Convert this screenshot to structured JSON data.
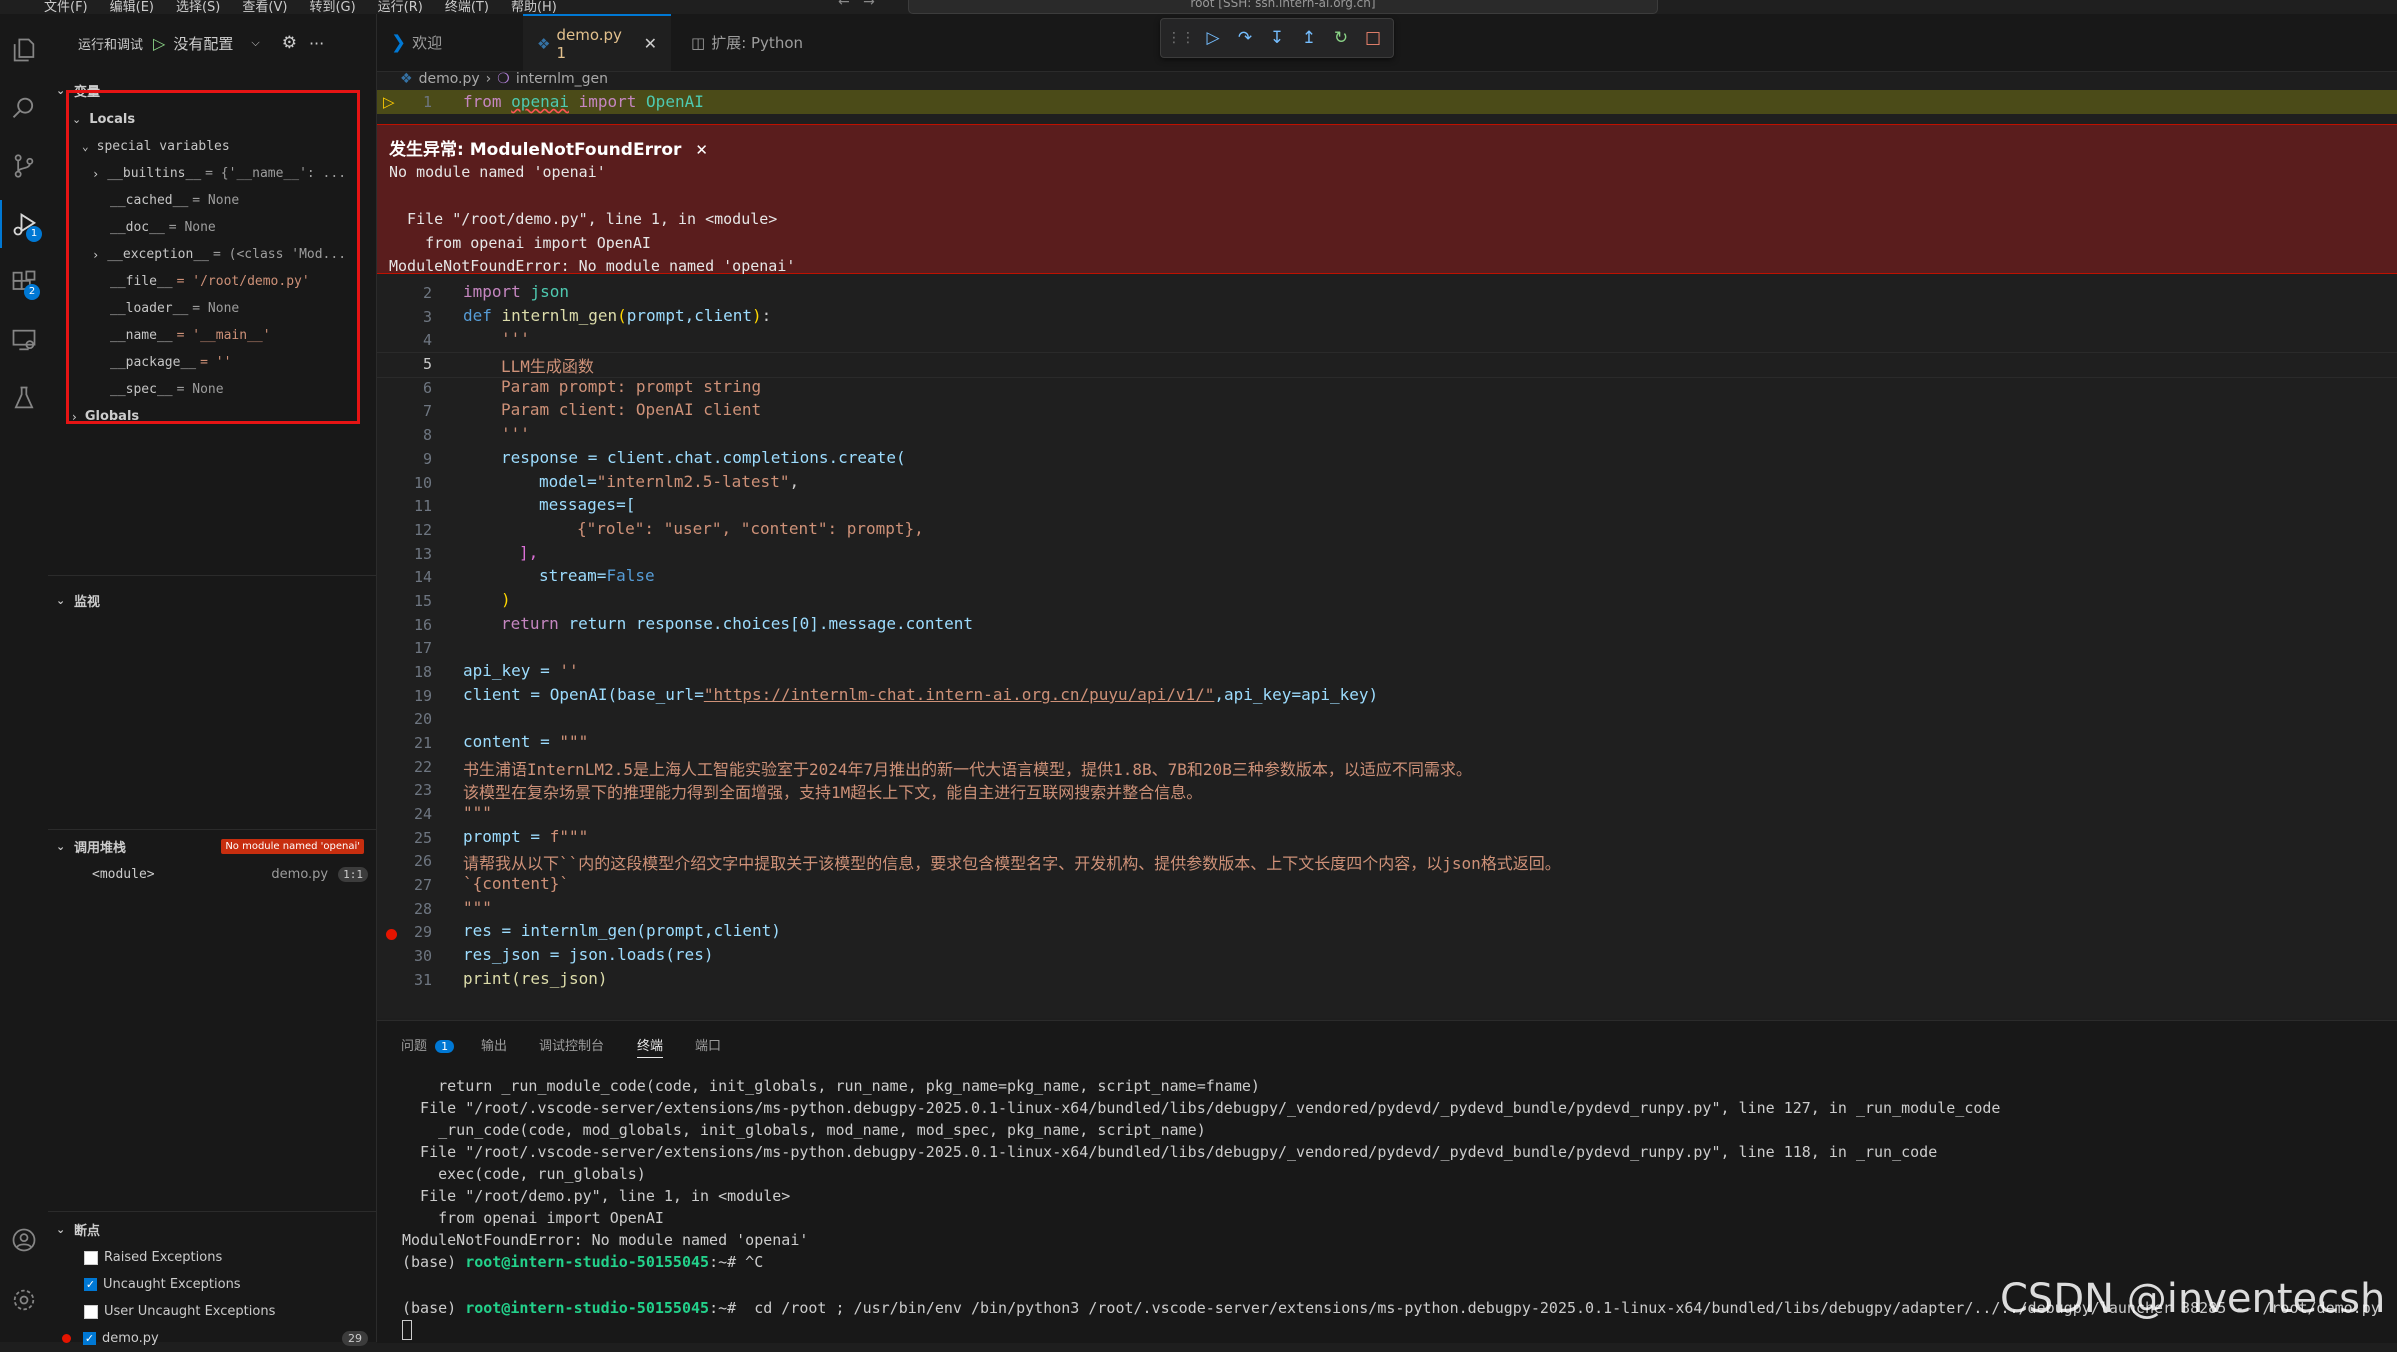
{
  "menu": [
    "文件(F)",
    "编辑(E)",
    "选择(S)",
    "查看(V)",
    "转到(G)",
    "运行(R)",
    "终端(T)",
    "帮助(H)"
  ],
  "command_center": "root [SSH: ssh.intern-ai.org.cn]",
  "activity_badges": {
    "debug": "1",
    "extensions": "2"
  },
  "sidebar": {
    "title": "运行和调试",
    "config": "没有配置",
    "variables_header": "变量",
    "locals_label": "Locals",
    "special_label": "special variables",
    "vars": [
      {
        "name": "__builtins__",
        "value": "= {'__name__': ..."
      },
      {
        "name": "__cached__",
        "value": "= None"
      },
      {
        "name": "__doc__",
        "value": "= None"
      },
      {
        "name": "__exception__",
        "value": "= (<class 'Mod..."
      },
      {
        "name": "__file__",
        "value": "= '/root/demo.py'"
      },
      {
        "name": "__loader__",
        "value": "= None"
      },
      {
        "name": "__name__",
        "value": "= '__main__'"
      },
      {
        "name": "__package__",
        "value": "= ''"
      },
      {
        "name": "__spec__",
        "value": "= None"
      }
    ],
    "globals_label": "Globals",
    "watch_header": "监视",
    "callstack_header": "调用堆栈",
    "callstack_badge": "No module named 'openai'",
    "callstack_frame": "<module>",
    "callstack_file": "demo.py",
    "callstack_pos": "1:1",
    "breakpoints_header": "断点",
    "bp_raised": "Raised Exceptions",
    "bp_uncaught": "Uncaught Exceptions",
    "bp_user": "User Uncaught Exceptions",
    "bp_file": "demo.py",
    "bp_line": "29"
  },
  "tabs": {
    "welcome": "欢迎",
    "demo": "demo.py 1",
    "ext": "扩展: Python"
  },
  "breadcrumb": {
    "file": "demo.py",
    "symbol": "internlm_gen"
  },
  "exception": {
    "title": "发生异常: ModuleNotFoundError",
    "lines": [
      "No module named 'openai'",
      "",
      "  File \"/root/demo.py\", line 1, in <module>",
      "    from openai import OpenAI",
      "ModuleNotFoundError: No module named 'openai'"
    ]
  },
  "code_line1": {
    "a": "from",
    "b": "openai",
    "c": "import",
    "d": "OpenAI"
  },
  "code": {
    "l2": "json",
    "l3fn": "internlm_gen",
    "l3args": "prompt,client",
    "l4": "'''",
    "l5": "LLM生成函数",
    "l6": "Param prompt: prompt string",
    "l7": "Param client: OpenAI client",
    "l8": "'''",
    "l9": "response = client.chat.completions.create(",
    "l10a": "model=",
    "l10b": "\"internlm2.5-latest\"",
    "l11": "messages=[",
    "l12": "{\"role\": \"user\", \"content\": prompt},",
    "l13": "],",
    "l14a": "stream=",
    "l14b": "False",
    "l15": ")",
    "l16": "return response.choices[0].message.content",
    "l18a": "api_key = ",
    "l18b": "''",
    "l19a": "client = OpenAI(base_url=",
    "l19b": "\"https://internlm-chat.intern-ai.org.cn/puyu/api/v1/\"",
    "l19c": ",api_key=api_key)",
    "l21a": "content = ",
    "l21b": "\"\"\"",
    "l22": "书生浦语InternLM2.5是上海人工智能实验室于2024年7月推出的新一代大语言模型，提供1.8B、7B和20B三种参数版本，以适应不同需求。",
    "l23": "该模型在复杂场景下的推理能力得到全面增强，支持1M超长上下文，能自主进行互联网搜索并整合信息。",
    "l24": "\"\"\"",
    "l25a": "prompt = ",
    "l25b": "f\"\"\"",
    "l26": "请帮我从以下``内的这段模型介绍文字中提取关于该模型的信息，要求包含模型名字、开发机构、提供参数版本、上下文长度四个内容，以json格式返回。",
    "l27": "`{content}`",
    "l28": "\"\"\"",
    "l29": "res = internlm_gen(prompt,client)",
    "l30": "res_json = json.loads(res)",
    "l31": "print(res_json)"
  },
  "panel": {
    "problems": "问题",
    "problems_count": "1",
    "output": "输出",
    "debug_console": "调试控制台",
    "terminal": "终端",
    "ports": "端口",
    "lines": [
      "    return _run_module_code(code, init_globals, run_name, pkg_name=pkg_name, script_name=fname)",
      "  File \"/root/.vscode-server/extensions/ms-python.debugpy-2025.0.1-linux-x64/bundled/libs/debugpy/_vendored/pydevd/_pydevd_bundle/pydevd_runpy.py\", line 127, in _run_module_code",
      "    _run_code(code, mod_globals, init_globals, mod_name, mod_spec, pkg_name, script_name)",
      "  File \"/root/.vscode-server/extensions/ms-python.debugpy-2025.0.1-linux-x64/bundled/libs/debugpy/_vendored/pydevd/_pydevd_bundle/pydevd_runpy.py\", line 118, in _run_code",
      "    exec(code, run_globals)",
      "  File \"/root/demo.py\", line 1, in <module>",
      "    from openai import OpenAI",
      "ModuleNotFoundError: No module named 'openai'"
    ],
    "prompt_base": "(base) ",
    "prompt_user": "root@intern-studio-50155045",
    "prompt_tail1": ":~# ^C",
    "prompt_tail2": ":~#  cd /root ; /usr/bin/env /bin/python3 /root/.vscode-server/extensions/ms-python.debugpy-2025.0.1-linux-x64/bundled/libs/debugpy/adapter/../../debugpy/launcher 38285 -- /root/demo.py"
  },
  "watermark": "CSDN @inventecsh"
}
